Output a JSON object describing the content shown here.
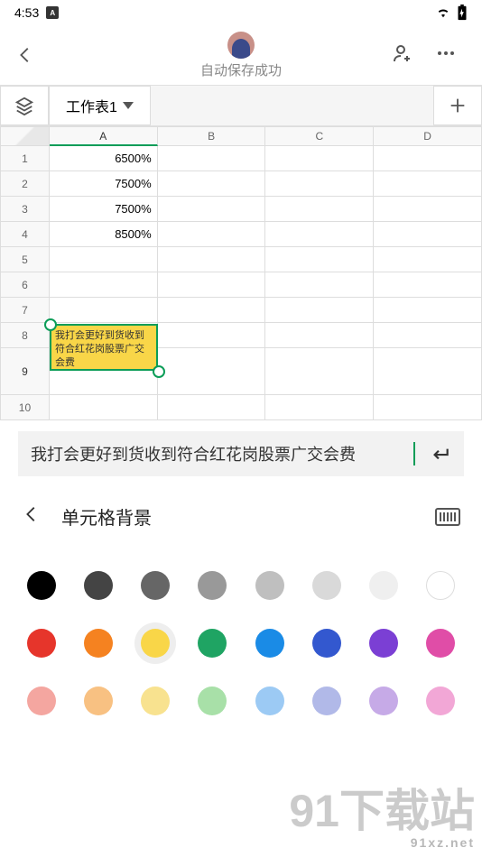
{
  "status": {
    "time": "4:53",
    "indicator": "A"
  },
  "header": {
    "save_text": "自动保存成功"
  },
  "sheet": {
    "tab_label": "工作表1"
  },
  "columns": [
    "A",
    "B",
    "C",
    "D"
  ],
  "rows": [
    "1",
    "2",
    "3",
    "4",
    "5",
    "6",
    "7",
    "8",
    "9",
    "10"
  ],
  "cells": {
    "A1": "6500%",
    "A2": "7500%",
    "A3": "7500%",
    "A4": "8500%"
  },
  "selected": {
    "cell": "A9",
    "text": "我打会更好到货收到符合红花岗股票广交会费"
  },
  "formula_bar": {
    "value": "我打会更好到货收到符合红花岗股票广交会费"
  },
  "panel": {
    "title": "单元格背景"
  },
  "palette": {
    "row1": [
      "#000000",
      "#444444",
      "#666666",
      "#999999",
      "#bfbfbf",
      "#d9d9d9",
      "#efefef",
      "#ffffff"
    ],
    "row2": [
      "#e6352b",
      "#f58220",
      "#f9d648",
      "#1fa463",
      "#1a8be6",
      "#3358cf",
      "#7b3fd4",
      "#e04da7"
    ],
    "row3": [
      "#f4a6a0",
      "#f8c182",
      "#f8e28f",
      "#a8e0a8",
      "#9ccaf4",
      "#b1b9e8",
      "#c6aae7",
      "#f2a7d6"
    ]
  },
  "watermark": {
    "name": "下载站",
    "url": "91xz.net"
  }
}
